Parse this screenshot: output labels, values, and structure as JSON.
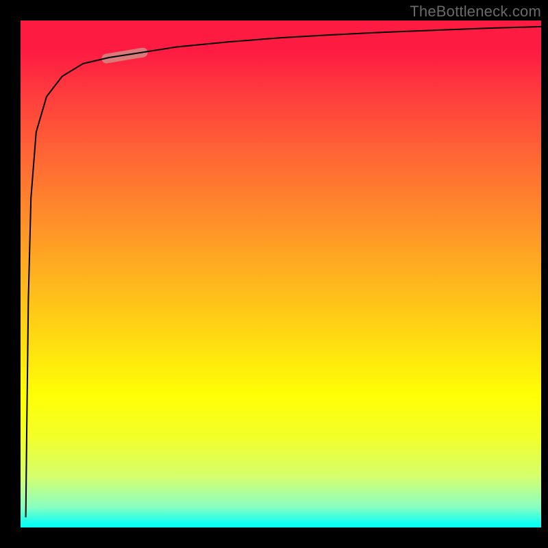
{
  "watermark": "TheBottleneck.com",
  "chart_data": {
    "type": "line",
    "title": "",
    "xlabel": "",
    "ylabel": "",
    "x_range": [
      0,
      1
    ],
    "y_range": [
      0,
      1
    ],
    "grid": false,
    "legend": false,
    "background_gradient": {
      "top": "#fe1b42",
      "mid": "#ffff05",
      "bottom": "#00fff8"
    },
    "frame_color": "#000000",
    "series": [
      {
        "name": "curve",
        "stroke": "#000000",
        "stroke_width": 2,
        "points": [
          {
            "x": 0.01,
            "y": 0.02
          },
          {
            "x": 0.012,
            "y": 0.2
          },
          {
            "x": 0.015,
            "y": 0.45
          },
          {
            "x": 0.02,
            "y": 0.65
          },
          {
            "x": 0.03,
            "y": 0.78
          },
          {
            "x": 0.05,
            "y": 0.85
          },
          {
            "x": 0.08,
            "y": 0.89
          },
          {
            "x": 0.12,
            "y": 0.915
          },
          {
            "x": 0.17,
            "y": 0.927
          },
          {
            "x": 0.22,
            "y": 0.935
          },
          {
            "x": 0.3,
            "y": 0.948
          },
          {
            "x": 0.4,
            "y": 0.958
          },
          {
            "x": 0.5,
            "y": 0.966
          },
          {
            "x": 0.6,
            "y": 0.972
          },
          {
            "x": 0.7,
            "y": 0.977
          },
          {
            "x": 0.8,
            "y": 0.981
          },
          {
            "x": 0.9,
            "y": 0.985
          },
          {
            "x": 1.0,
            "y": 0.988
          }
        ]
      },
      {
        "name": "highlight-segment",
        "stroke": "#d28b84",
        "stroke_width": 14,
        "opacity": 0.85,
        "points": [
          {
            "x": 0.165,
            "y": 0.925
          },
          {
            "x": 0.235,
            "y": 0.937
          }
        ]
      }
    ]
  }
}
